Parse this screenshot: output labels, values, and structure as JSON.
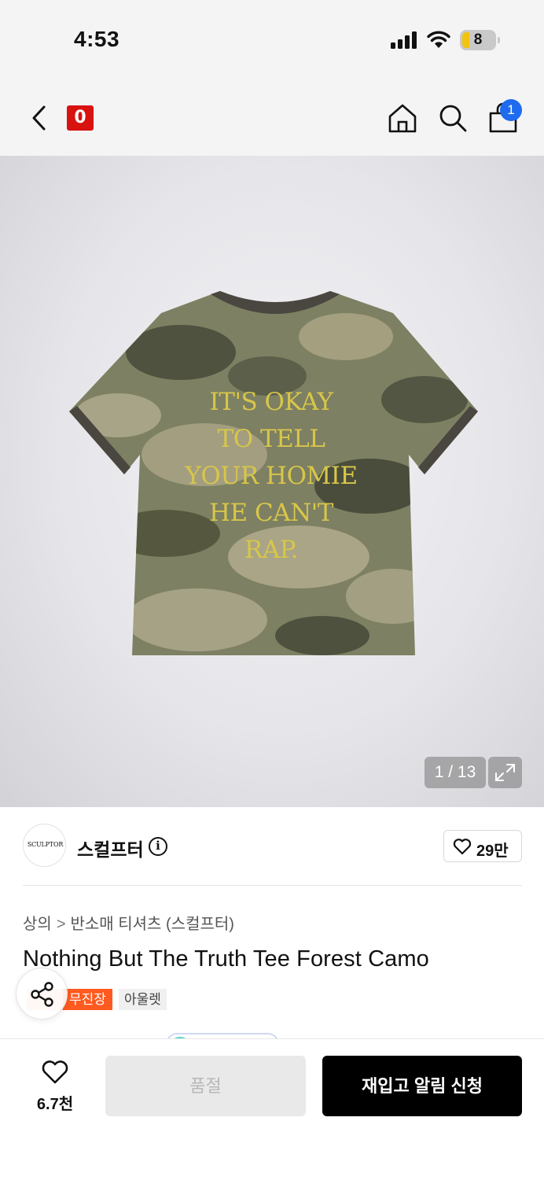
{
  "status_bar": {
    "time": "4:53",
    "battery": "8",
    "colors": {
      "battery_fill": "#f2c311"
    }
  },
  "header": {
    "logo_text": "0",
    "cart_count": "1",
    "colors": {
      "logo_bg": "#d8120f",
      "badge_bg": "#1f6bf0"
    },
    "icons": [
      "back-chevron-icon",
      "home-icon",
      "search-icon",
      "cart-bag-icon"
    ]
  },
  "gallery": {
    "counter": "1 / 13",
    "shirt_print": [
      "IT'S OKAY",
      "TO TELL",
      "YOUR HOMIE",
      "HE CAN'T",
      "RAP."
    ]
  },
  "brand": {
    "logo_text": "SCULPTOR",
    "name": "스컬프터",
    "info_glyph": "i",
    "likes": "29만"
  },
  "product": {
    "breadcrumb": [
      "상의",
      "반소매 티셔츠 (스컬프터)"
    ],
    "breadcrumb_sep": ">",
    "title": "Nothing But The Truth Tee Forest Camo",
    "tags": [
      "무진장",
      "아울렛"
    ],
    "colors": {
      "tag_primary": "#ff5a1f"
    }
  },
  "bottom_bar": {
    "wish_count": "6.7천",
    "soldout_label": "품절",
    "restock_label": "재입고 알림 신청"
  }
}
